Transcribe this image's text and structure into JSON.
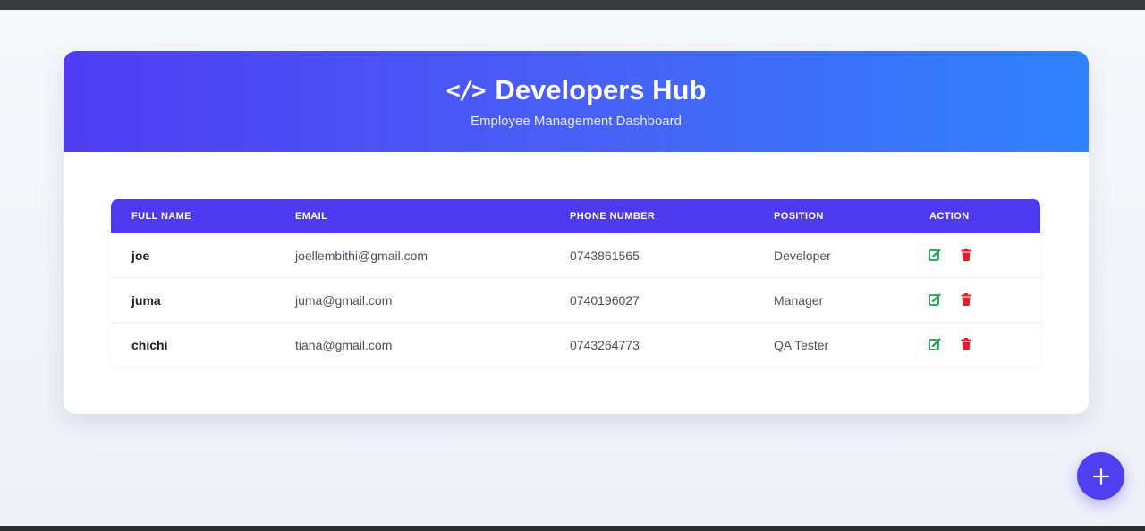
{
  "header": {
    "icon": "code-icon",
    "icon_glyph": "</>",
    "title": "Developers Hub",
    "subtitle": "Employee Management Dashboard"
  },
  "table": {
    "columns": [
      "FULL NAME",
      "EMAIL",
      "PHONE NUMBER",
      "POSITION",
      "ACTION"
    ],
    "rows": [
      {
        "name": "joe",
        "email": "joellembithi@gmail.com",
        "phone": "0743861565",
        "position": "Developer"
      },
      {
        "name": "juma",
        "email": "juma@gmail.com",
        "phone": "0740196027",
        "position": "Manager"
      },
      {
        "name": "chichi",
        "email": "tiana@gmail.com",
        "phone": "0743264773",
        "position": "QA Tester"
      }
    ],
    "actions": {
      "edit_icon": "edit-icon",
      "delete_icon": "trash-icon"
    }
  },
  "fab": {
    "icon": "plus-icon"
  },
  "colors": {
    "header_gradient_start": "#4f3cf4",
    "header_gradient_end": "#2f82fc",
    "table_header": "#4d39ee",
    "edit_green": "#16a34a",
    "delete_red": "#e11d2e",
    "fab": "#4f3ff0"
  }
}
